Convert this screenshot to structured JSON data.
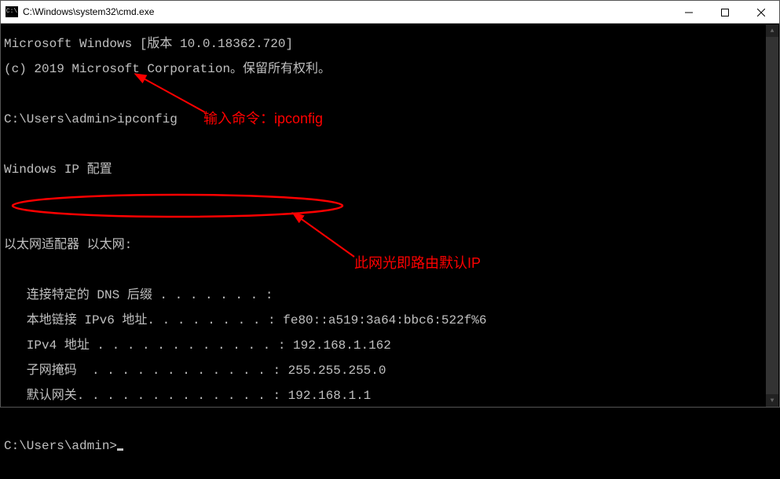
{
  "window": {
    "title": "C:\\Windows\\system32\\cmd.exe",
    "icon_label": "C:\\"
  },
  "terminal": {
    "line1": "Microsoft Windows [版本 10.0.18362.720]",
    "line2": "(c) 2019 Microsoft Corporation。保留所有权利。",
    "prompt1": "C:\\Users\\admin>",
    "command1": "ipconfig",
    "ipconfig_header": "Windows IP 配置",
    "adapter_header": "以太网适配器 以太网:",
    "dns_line": "   连接特定的 DNS 后缀 . . . . . . . :",
    "ipv6_line": "   本地链接 IPv6 地址. . . . . . . . : fe80::a519:3a64:bbc6:522f%6",
    "ipv4_line": "   IPv4 地址 . . . . . . . . . . . . : 192.168.1.162",
    "mask_line": "   子网掩码  . . . . . . . . . . . . : 255.255.255.0",
    "gw_line": "   默认网关. . . . . . . . . . . . . : 192.168.1.1",
    "prompt2": "C:\\Users\\admin>"
  },
  "annotations": {
    "top": "输入命令：ipconfig",
    "bottom": "此网光即路由默认IP"
  },
  "network": {
    "ipv6": "fe80::a519:3a64:bbc6:522f%6",
    "ipv4": "192.168.1.162",
    "mask": "255.255.255.0",
    "gateway": "192.168.1.1"
  }
}
